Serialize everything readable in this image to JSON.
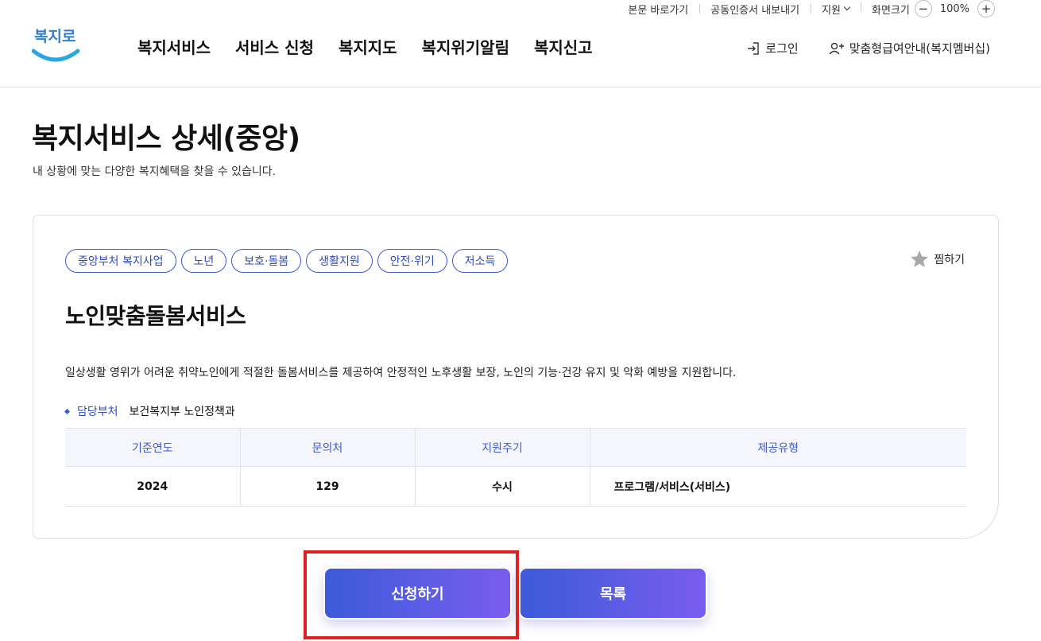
{
  "utility": {
    "skip_link": "본문 바로가기",
    "cert_export": "공동인증서 내보내기",
    "support": "지원",
    "screen_size": "화면크기",
    "zoom_out": "−",
    "zoom_value": "100%",
    "zoom_in": "+"
  },
  "logo": {
    "text": "복지로"
  },
  "nav": {
    "items": [
      "복지서비스",
      "서비스 신청",
      "복지지도",
      "복지위기알림",
      "복지신고"
    ]
  },
  "header_right": {
    "login": "로그인",
    "membership": "맞춤형급여안내(복지멤버십)"
  },
  "page": {
    "title": "복지서비스 상세(중앙)",
    "subtitle": "내 상황에 맞는 다양한 복지혜택을 찾을 수 있습니다."
  },
  "card": {
    "tags": [
      "중앙부처 복지사업",
      "노년",
      "보호·돌봄",
      "생활지원",
      "안전·위기",
      "저소득"
    ],
    "favorite_label": "찜하기",
    "service_title": "노인맞춤돌봄서비스",
    "description": "일상생활 영위가 어려운 취약노인에게 적절한 돌봄서비스를 제공하여 안정적인 노후생활 보장, 노인의 기능·건강 유지 및 악화 예방을 지원합니다.",
    "dept_label": "담당부처",
    "dept_value": "보건복지부 노인정책과",
    "table": {
      "headers": [
        "기준연도",
        "문의처",
        "지원주기",
        "제공유형"
      ],
      "row": [
        "2024",
        "129",
        "수시",
        "프로그램/서비스(서비스)"
      ]
    }
  },
  "buttons": {
    "apply": "신청하기",
    "list": "목록"
  },
  "colors": {
    "accent": "#3d5ad1",
    "button_gradient_start": "#3b5bd9",
    "button_gradient_end": "#7a5cf0",
    "highlight": "#e02020"
  }
}
